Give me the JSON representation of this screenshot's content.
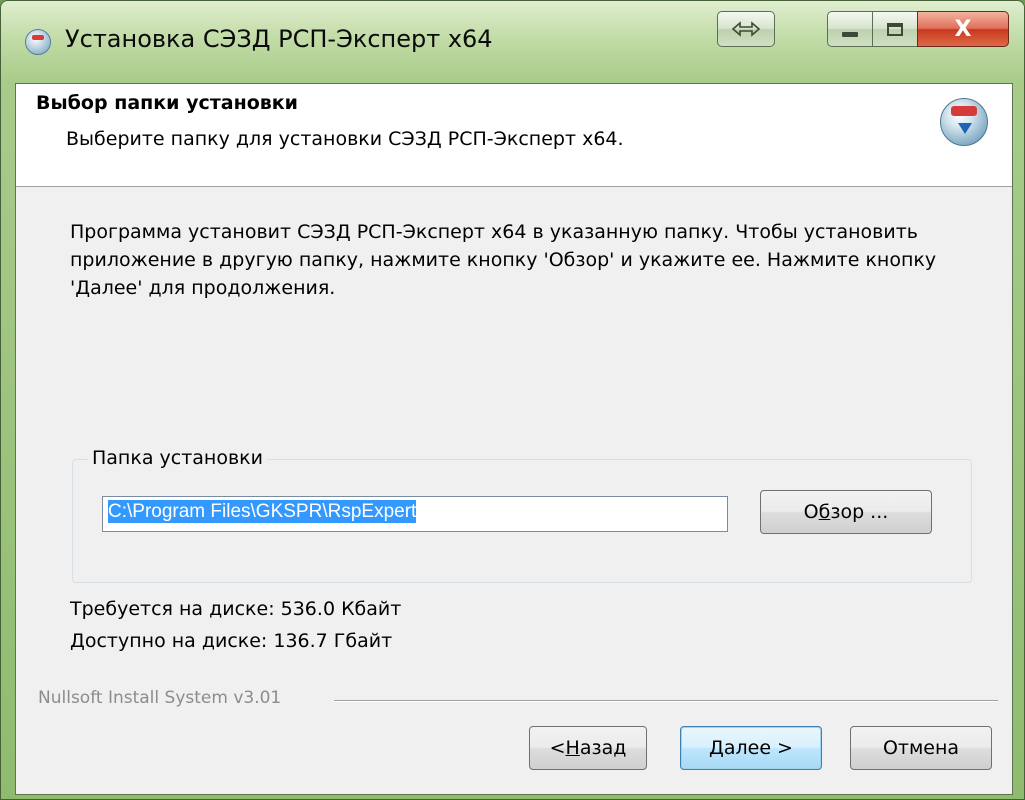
{
  "window": {
    "title": "Установка СЭЗД РСП-Эксперт x64",
    "close_glyph": "X"
  },
  "header": {
    "title": "Выбор папки установки",
    "subtitle": "Выберите папку для установки СЭЗД РСП-Эксперт x64."
  },
  "body": {
    "description": "Программа установит СЭЗД РСП-Эксперт x64 в указанную папку. Чтобы установить приложение в другую папку, нажмите кнопку 'Обзор' и укажите ее. Нажмите кнопку 'Далее' для продолжения."
  },
  "folder": {
    "group_label": "Папка установки",
    "path_value": "C:\\Program Files\\GKSPR\\RspExpert",
    "browse_prefix": "О",
    "browse_hotkey": "б",
    "browse_rest": "зор ..."
  },
  "disk": {
    "required": "Требуется на диске: 536.0 Кбайт",
    "available": "Доступно на диске: 136.7 Гбайт"
  },
  "footer": {
    "brand": "Nullsoft Install System v3.01",
    "back_prefix": "< ",
    "back_hotkey": "Н",
    "back_rest": "азад",
    "next_label": "Далее >",
    "cancel_label": "Отмена"
  },
  "colors": {
    "frame_accent": "#a9cc8c",
    "selection": "#3399ff",
    "default_button": "#3c7fb1"
  },
  "icons": {
    "title": "installer-disc-icon",
    "header": "install-disc-download-icon",
    "resize": "resize-arrows-icon",
    "minimize": "minimize-icon",
    "maximize": "maximize-icon",
    "close": "close-icon"
  }
}
